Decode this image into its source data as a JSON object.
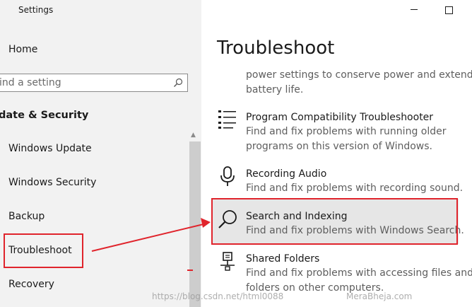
{
  "window": {
    "title": "Settings"
  },
  "sidebar": {
    "home": "Home",
    "search_placeholder": "ind a setting",
    "section": "date & Security",
    "items": [
      {
        "label": "Windows Update"
      },
      {
        "label": "Windows Security"
      },
      {
        "label": "Backup"
      },
      {
        "label": "Troubleshoot"
      },
      {
        "label": "Recovery"
      }
    ]
  },
  "main": {
    "title": "Troubleshoot",
    "partial_desc": [
      "power settings to conserve power and extend",
      "battery life."
    ],
    "items": [
      {
        "title": "Program Compatibility Troubleshooter",
        "desc": [
          "Find and fix problems with running older",
          "programs on this version of Windows."
        ],
        "icon": "list-icon"
      },
      {
        "title": "Recording Audio",
        "desc": [
          "Find and fix problems with recording sound."
        ],
        "icon": "microphone-icon"
      },
      {
        "title": "Search and Indexing",
        "desc": [
          "Find and fix problems with Windows Search."
        ],
        "icon": "search-icon"
      },
      {
        "title": "Shared Folders",
        "desc": [
          "Find and fix problems with accessing files and",
          "folders on other computers."
        ],
        "icon": "shared-folder-icon"
      }
    ]
  },
  "watermarks": [
    "https://blog.csdn.net/html0088",
    "MeraBheja.com"
  ],
  "colors": {
    "highlight": "#e0242c",
    "sidebar_bg": "#f2f2f2",
    "selected_bg": "#e6e6e6"
  }
}
